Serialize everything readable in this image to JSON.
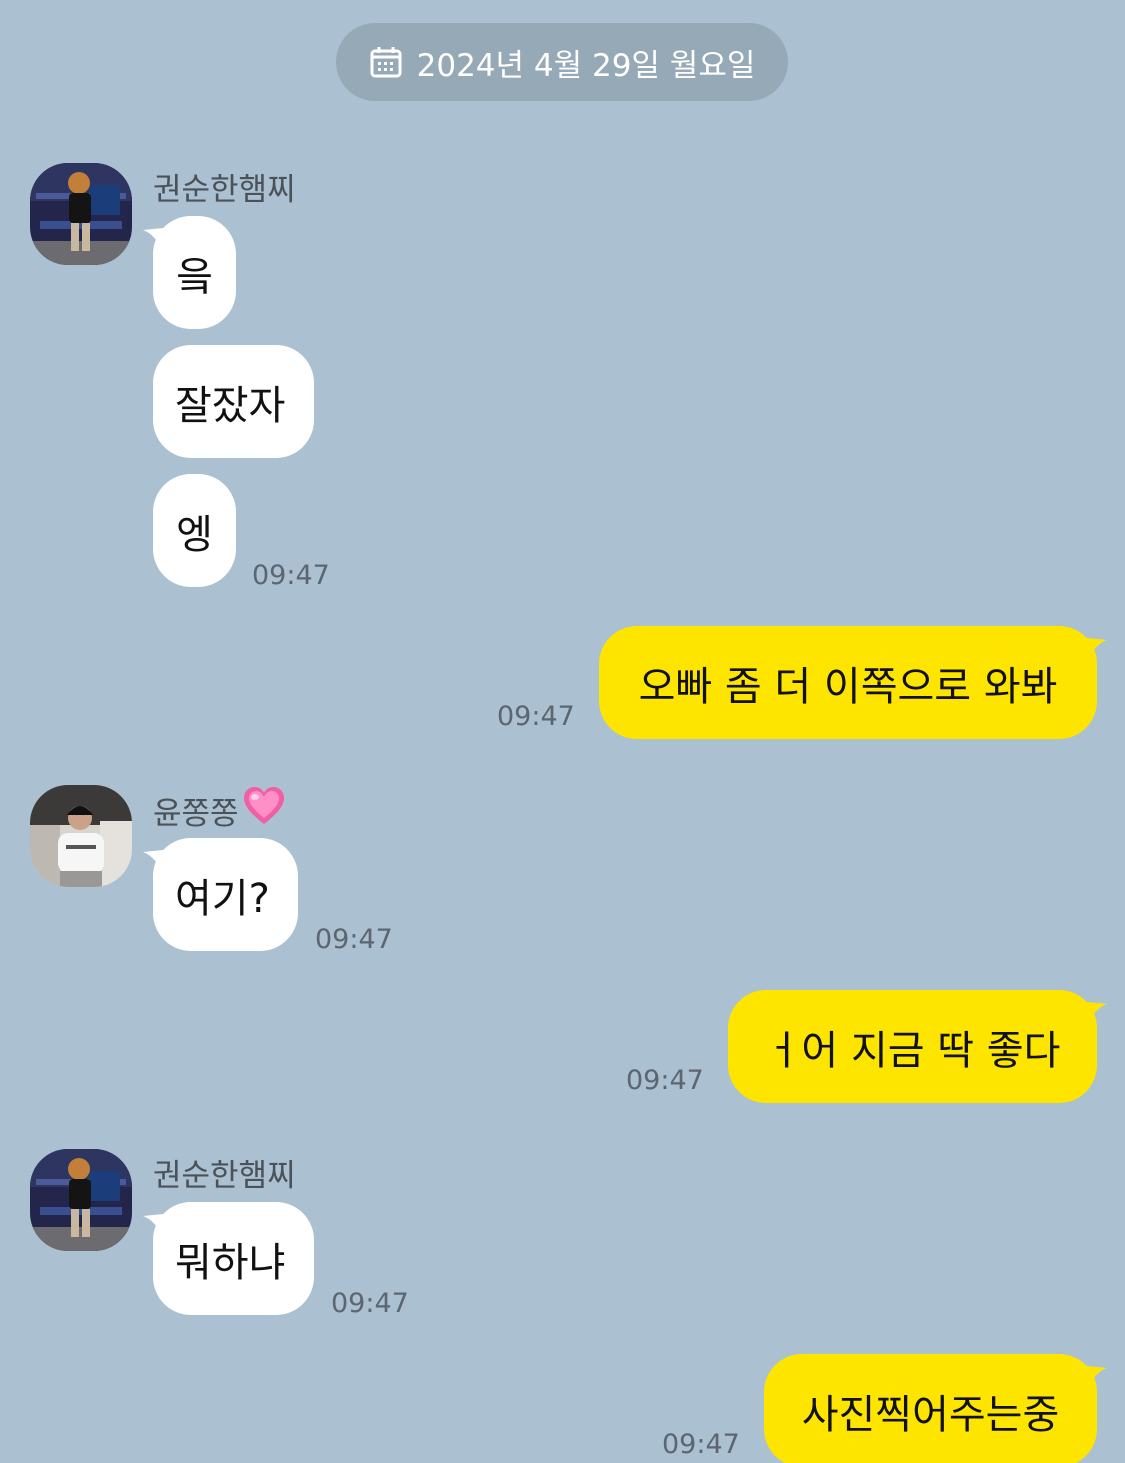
{
  "date_divider": {
    "label": "2024년 4월 29일 월요일",
    "icon": "calendar-icon"
  },
  "messages": [
    {
      "side": "in",
      "sender": "권순한햄찌",
      "lines": [
        "읔",
        "잘잤자",
        "엥"
      ],
      "time": "09:47"
    },
    {
      "side": "out",
      "text": "오빠 좀 더 이쪽으로 와봐",
      "time": "09:47"
    },
    {
      "side": "in",
      "sender": "윤쫑쫑",
      "sender_emoji": "pink-heart",
      "lines": [
        "여기?"
      ],
      "time": "09:47"
    },
    {
      "side": "out",
      "text": "ㅓ어 지금 딱 좋다",
      "time": "09:47"
    },
    {
      "side": "in",
      "sender": "권순한햄찌",
      "lines": [
        "뭐하냐"
      ],
      "time": "09:47"
    },
    {
      "side": "out",
      "text": "사진찍어주는중",
      "time": "09:47"
    }
  ],
  "colors": {
    "background": "#abc1d1",
    "incoming_bubble": "#ffffff",
    "outgoing_bubble": "#fee500",
    "date_pill": "#96a9b6"
  }
}
